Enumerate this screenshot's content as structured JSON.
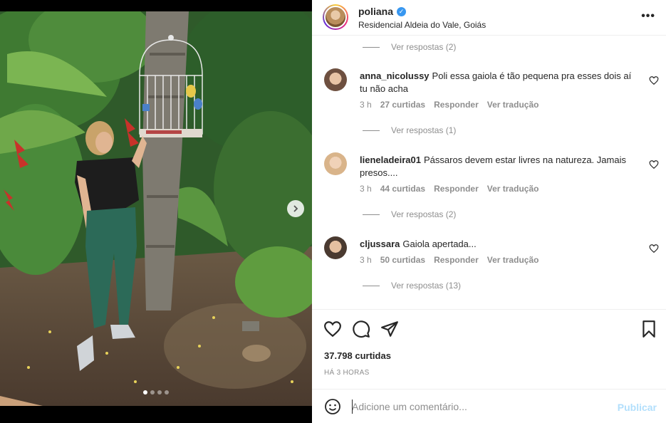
{
  "post": {
    "username": "poliana",
    "location": "Residencial Aldeia do Vale, Goiás",
    "more_icon": "more-horizontal-icon"
  },
  "comments": {
    "top_replies": "Ver respostas (2)",
    "items": [
      {
        "user": "anna_nicolussy",
        "text": "Poli essa gaiola é tão pequena pra esses dois aí tu não acha",
        "time": "3 h",
        "likes": "27 curtidas",
        "reply": "Responder",
        "translate": "Ver tradução",
        "replies": "Ver respostas (1)"
      },
      {
        "user": "lieneladeira01",
        "text": "Pássaros devem estar livres na natureza. Jamais presos....",
        "time": "3 h",
        "likes": "44 curtidas",
        "reply": "Responder",
        "translate": "Ver tradução",
        "replies": "Ver respostas (2)"
      },
      {
        "user": "cljussara",
        "text": "Gaiola apertada...",
        "time": "3 h",
        "likes": "50 curtidas",
        "reply": "Responder",
        "translate": "Ver tradução",
        "replies": "Ver respostas (13)"
      }
    ]
  },
  "actions": {
    "likes": "37.798 curtidas",
    "time": "HÁ 3 HORAS",
    "icons": [
      "heart-icon",
      "comment-icon",
      "share-icon",
      "bookmark-icon"
    ]
  },
  "add_comment": {
    "placeholder": "Adicione um comentário...",
    "publish": "Publicar"
  },
  "carousel": {
    "current": 1,
    "total": 4
  },
  "colors": {
    "link_disabled": "#b2dffc",
    "muted": "#8e8e8e",
    "verified": "#3897f0"
  }
}
